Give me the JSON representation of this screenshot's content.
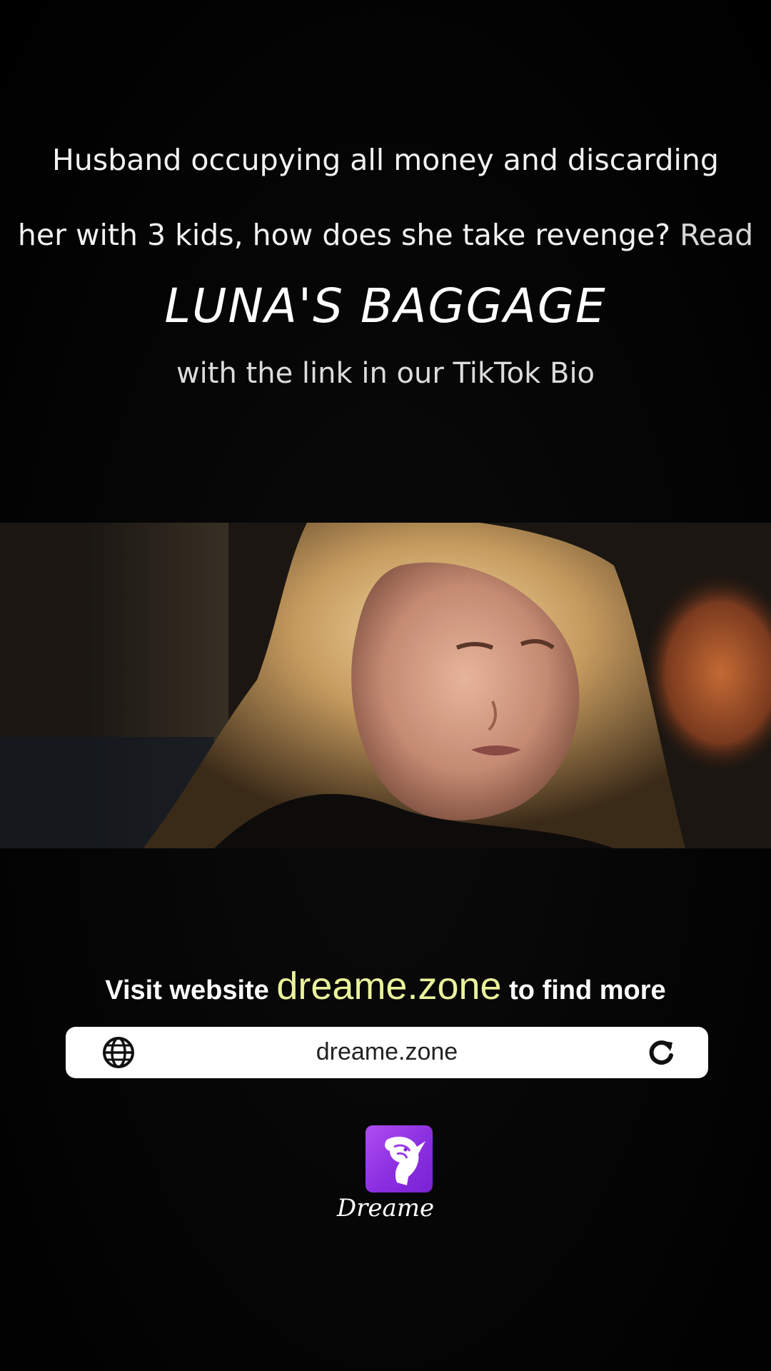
{
  "promo": {
    "line1": "Husband occupying all money and discarding",
    "line2_main": "her with 3 kids, how does she take revenge?",
    "line2_read": "Read",
    "book_title": "LUNA'S BAGGAGE",
    "line4": "with the link in our TikTok Bio"
  },
  "video": {
    "scene": "woman-with-blonde-hair-speaking"
  },
  "visit": {
    "prefix": "Visit website",
    "domain": "dreame.zone",
    "suffix": "to find more"
  },
  "url_bar": {
    "url": "dreame.zone",
    "left_icon": "globe-icon",
    "right_icon": "reload-icon"
  },
  "brand": {
    "logo_icon": "unicorn-head-icon",
    "name": "Dreame",
    "accent_color": "#9b3be8",
    "highlight_color": "#eaf39a"
  }
}
